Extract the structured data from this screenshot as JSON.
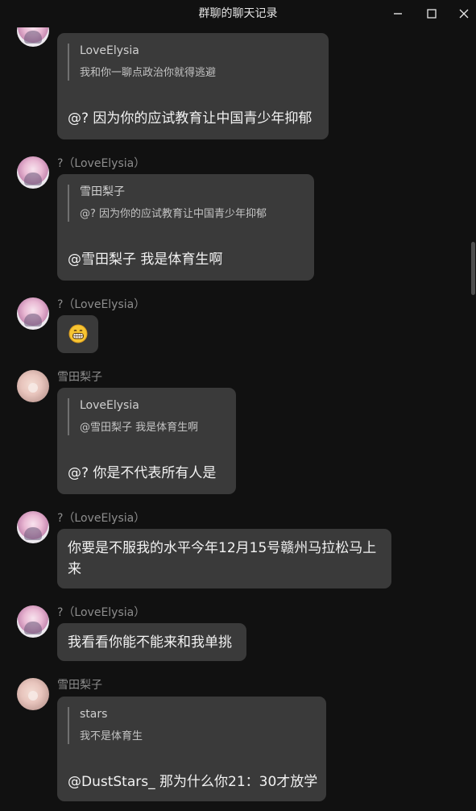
{
  "window": {
    "title": "群聊的聊天记录",
    "minimize_icon": "minimize-icon",
    "maximize_icon": "maximize-icon",
    "close_icon": "close-icon"
  },
  "messages": [
    {
      "sender": "",
      "avatar": "elysia",
      "quote": {
        "author": "LoveElysia",
        "text": "我和你一聊点政治你就得逃避"
      },
      "text": "@? 因为你的应试教育让中国青少年抑郁"
    },
    {
      "sender": "?（LoveElysia）",
      "avatar": "elysia",
      "quote": {
        "author": "雪田梨子",
        "text": "@? 因为你的应试教育让中国青少年抑郁"
      },
      "text": "@雪田梨子 我是体育生啊"
    },
    {
      "sender": "?（LoveElysia）",
      "avatar": "elysia",
      "emoji": "grinning-face-emoji"
    },
    {
      "sender": "雪田梨子",
      "avatar": "yuki",
      "quote": {
        "author": "LoveElysia",
        "text": "@雪田梨子 我是体育生啊"
      },
      "text": "@? 你是不代表所有人是"
    },
    {
      "sender": "?（LoveElysia）",
      "avatar": "elysia",
      "text": "你要是不服我的水平今年12月15号赣州马拉松马上来"
    },
    {
      "sender": "?（LoveElysia）",
      "avatar": "elysia",
      "text": "我看看你能不能来和我单挑"
    },
    {
      "sender": "雪田梨子",
      "avatar": "yuki",
      "quote": {
        "author": "stars",
        "text": "我不是体育生"
      },
      "text": "@DustStars_ 那为什么你21：30才放学"
    }
  ],
  "colors": {
    "background": "#111111",
    "bubble": "#3a3a3a",
    "sender": "#8d8d8d",
    "text": "#f2f2f2"
  }
}
